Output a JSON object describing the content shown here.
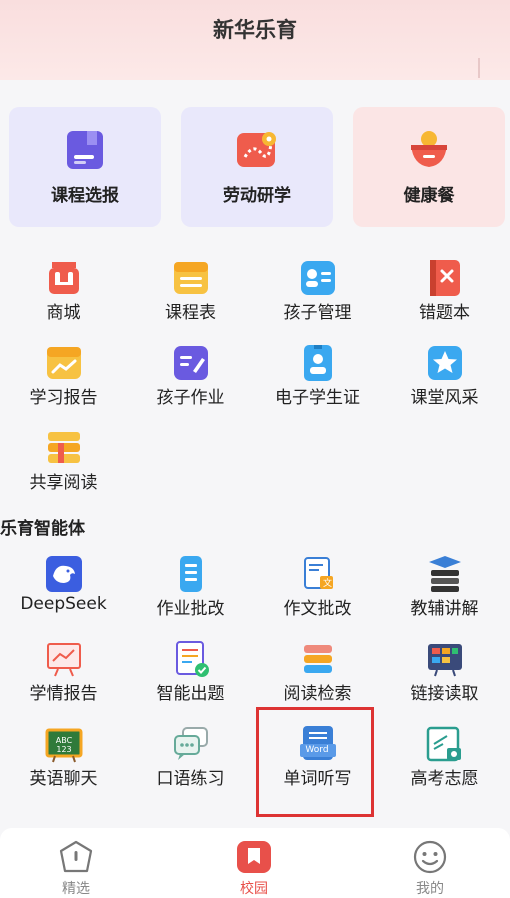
{
  "app": {
    "title": "新华乐育"
  },
  "cards": [
    {
      "label": "课程选报",
      "icon": "course-select-icon",
      "bg": "#e9e8fb"
    },
    {
      "label": "劳动研学",
      "icon": "map-route-icon",
      "bg": "#e9e8fb"
    },
    {
      "label": "健康餐",
      "icon": "meal-bowl-icon",
      "bg": "#fbe5e5"
    }
  ],
  "services": [
    {
      "label": "商城",
      "icon": "shop-basket-icon"
    },
    {
      "label": "课程表",
      "icon": "schedule-icon"
    },
    {
      "label": "孩子管理",
      "icon": "child-card-icon"
    },
    {
      "label": "错题本",
      "icon": "error-book-icon"
    },
    {
      "label": "学习报告",
      "icon": "study-report-icon"
    },
    {
      "label": "孩子作业",
      "icon": "homework-icon"
    },
    {
      "label": "电子学生证",
      "icon": "student-id-icon"
    },
    {
      "label": "课堂风采",
      "icon": "star-icon"
    },
    {
      "label": "共享阅读",
      "icon": "books-icon"
    }
  ],
  "ai_section": {
    "title": "乐育智能体"
  },
  "ai_tools": [
    {
      "label": "DeepSeek",
      "icon": "deepseek-icon"
    },
    {
      "label": "作业批改",
      "icon": "homework-grading-icon"
    },
    {
      "label": "作文批改",
      "icon": "essay-grading-icon"
    },
    {
      "label": "教辅讲解",
      "icon": "tutoring-icon"
    },
    {
      "label": "学情报告",
      "icon": "learning-report-icon"
    },
    {
      "label": "智能出题",
      "icon": "question-generator-icon"
    },
    {
      "label": "阅读检索",
      "icon": "reading-search-icon"
    },
    {
      "label": "链接读取",
      "icon": "link-reader-icon"
    },
    {
      "label": "英语聊天",
      "icon": "english-chat-icon",
      "badge": "ABC 123"
    },
    {
      "label": "口语练习",
      "icon": "speaking-icon"
    },
    {
      "label": "单词听写",
      "icon": "word-dictation-icon",
      "badge": "Word"
    },
    {
      "label": "高考志愿",
      "icon": "college-application-icon"
    }
  ],
  "tabs": [
    {
      "label": "精选",
      "icon": "home-icon",
      "active": false
    },
    {
      "label": "校园",
      "icon": "campus-icon",
      "active": true
    },
    {
      "label": "我的",
      "icon": "profile-icon",
      "active": false
    }
  ],
  "colors": {
    "accent": "#e8504a",
    "highlight": "#d33333"
  }
}
